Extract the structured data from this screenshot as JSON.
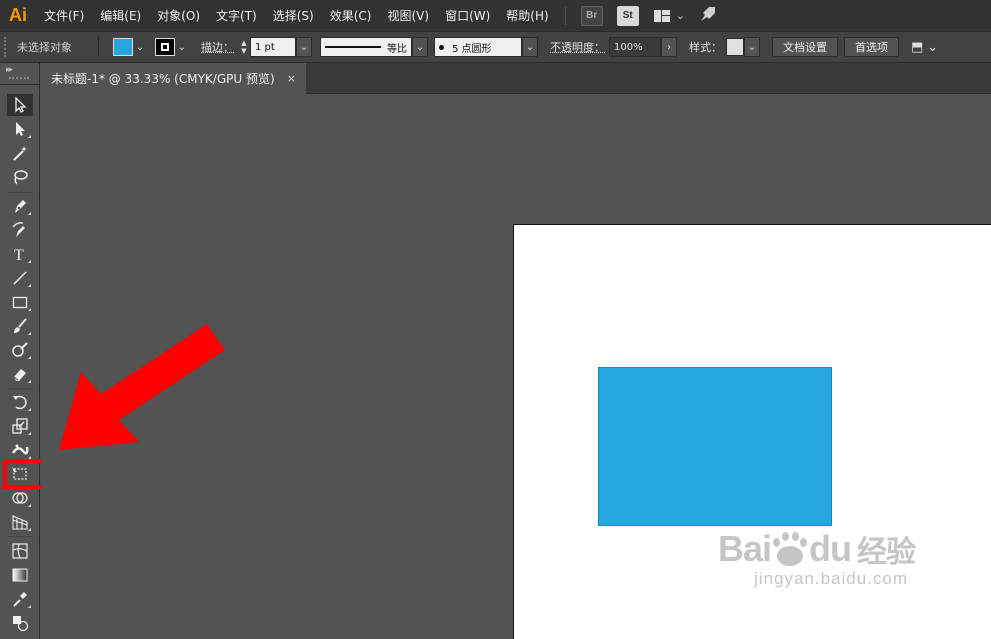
{
  "app": {
    "logo": "Ai"
  },
  "menu": [
    {
      "label": "文件(F)"
    },
    {
      "label": "编辑(E)"
    },
    {
      "label": "对象(O)"
    },
    {
      "label": "文字(T)"
    },
    {
      "label": "选择(S)"
    },
    {
      "label": "效果(C)"
    },
    {
      "label": "视图(V)"
    },
    {
      "label": "窗口(W)"
    },
    {
      "label": "帮助(H)"
    }
  ],
  "menu_extras": {
    "bridge": "Br",
    "stock": "St"
  },
  "control": {
    "selection": "未选择对象",
    "fill_color": "#27a4dd",
    "stroke_label": "描边：",
    "stroke_weight": "1 pt",
    "stroke_profile": "等比",
    "brush": "5 点圆形",
    "opacity_label": "不透明度：",
    "opacity": "100%",
    "style_label": "样式：",
    "doc_setup": "文档设置",
    "preferences": "首选项"
  },
  "tabs": [
    {
      "label": "未标题-1* @ 33.33% (CMYK/GPU 预览)",
      "close": "×"
    }
  ],
  "tools": [
    {
      "name": "selection-tool-icon"
    },
    {
      "name": "direct-selection-tool-icon"
    },
    {
      "name": "magic-wand-tool-icon"
    },
    {
      "name": "lasso-tool-icon"
    },
    {
      "name": "pen-tool-icon"
    },
    {
      "name": "curvature-tool-icon"
    },
    {
      "name": "type-tool-icon",
      "glyph": "T"
    },
    {
      "name": "line-tool-icon"
    },
    {
      "name": "rectangle-tool-icon"
    },
    {
      "name": "paintbrush-tool-icon"
    },
    {
      "name": "shaper-tool-icon"
    },
    {
      "name": "eraser-tool-icon"
    },
    {
      "name": "rotate-tool-icon"
    },
    {
      "name": "scale-tool-icon"
    },
    {
      "name": "width-tool-icon"
    },
    {
      "name": "free-transform-tool-icon"
    },
    {
      "name": "shape-builder-tool-icon"
    },
    {
      "name": "perspective-grid-tool-icon"
    },
    {
      "name": "mesh-tool-icon"
    },
    {
      "name": "gradient-tool-icon"
    },
    {
      "name": "eyedropper-tool-icon"
    },
    {
      "name": "blend-tool-icon"
    }
  ],
  "canvas": {
    "rect_color": "#26a6e0",
    "annotation_arrow_color": "#ff0000"
  },
  "watermark": {
    "brand_left": "Bai",
    "brand_right": "du",
    "product": "经验",
    "url": "jingyan.baidu.com"
  }
}
